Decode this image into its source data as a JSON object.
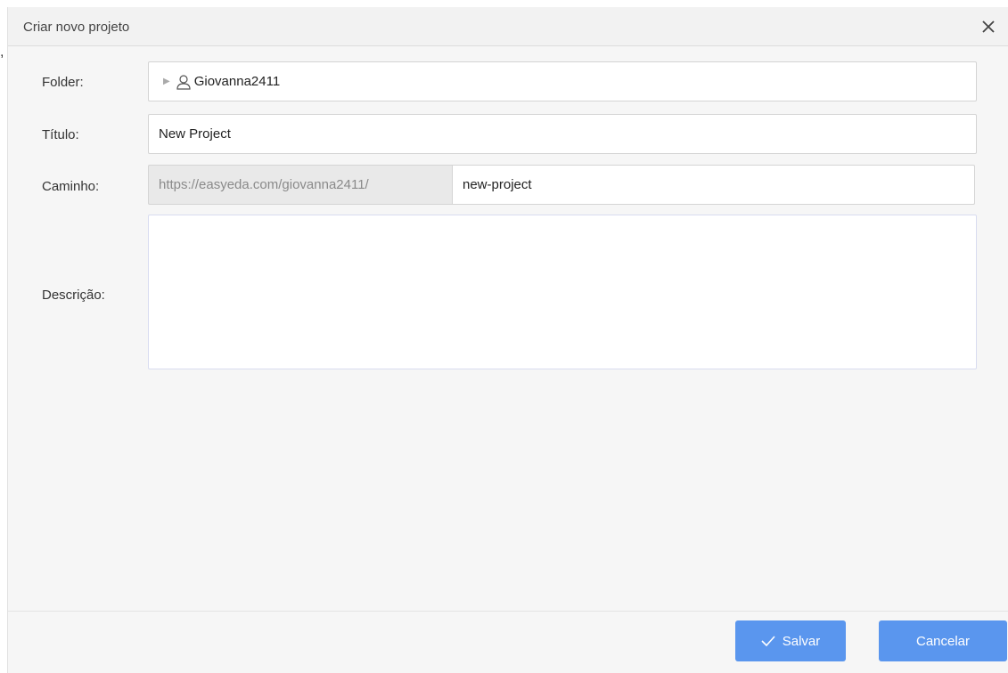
{
  "backdrop": {
    "stray_text": ","
  },
  "dialog": {
    "title": "Criar novo projeto",
    "close_icon": "close-icon"
  },
  "form": {
    "folder": {
      "label": "Folder:",
      "value": "Giovanna2411",
      "icon": "user-icon"
    },
    "title": {
      "label": "Título:",
      "value": "New Project"
    },
    "path": {
      "label": "Caminho:",
      "prefix": "https://easyeda.com/giovanna2411/",
      "value": "new-project"
    },
    "description": {
      "label": "Descrição:",
      "value": ""
    }
  },
  "footer": {
    "save_label": "Salvar",
    "cancel_label": "Cancelar"
  },
  "colors": {
    "accent": "#5a96ee",
    "dialog_bg": "#f6f6f6",
    "prefix_bg": "#e9e9e9"
  }
}
